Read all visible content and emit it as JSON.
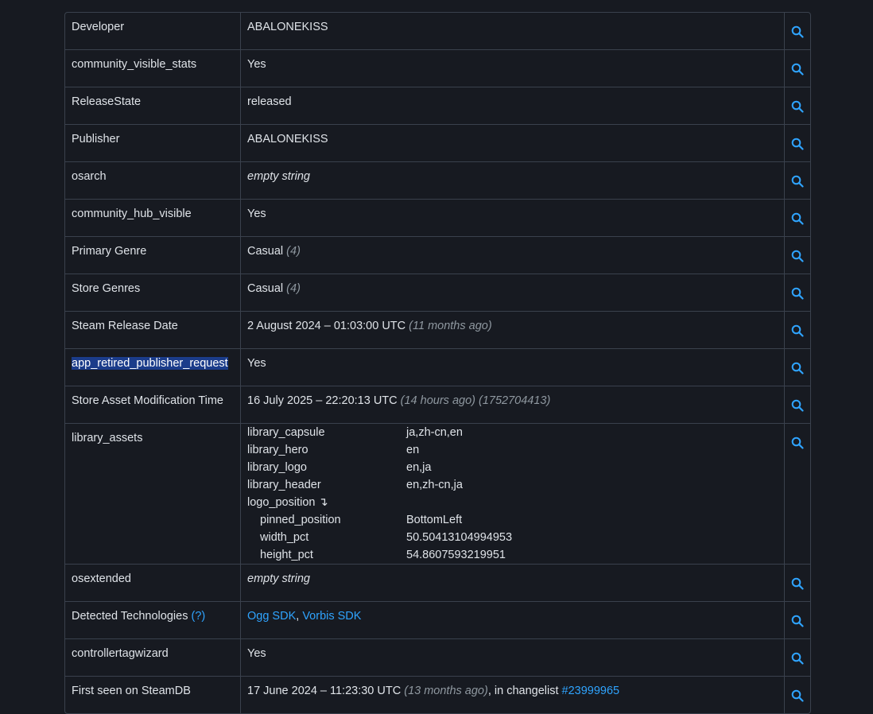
{
  "rows": [
    {
      "key": "Developer",
      "value": "ABALONEKISS"
    },
    {
      "key": "community_visible_stats",
      "value": "Yes"
    },
    {
      "key": "ReleaseState",
      "value": "released"
    },
    {
      "key": "Publisher",
      "value": "ABALONEKISS"
    },
    {
      "key": "osarch",
      "value": "empty string"
    },
    {
      "key": "community_hub_visible",
      "value": "Yes"
    },
    {
      "key": "Primary Genre",
      "value": "Casual",
      "extra": "(4)"
    },
    {
      "key": "Store Genres",
      "value": "Casual",
      "extra": "(4)"
    },
    {
      "key": "Steam Release Date",
      "value": "2 August 2024 – 01:03:00 UTC",
      "extra": "(11 months ago)"
    },
    {
      "key": "app_retired_publisher_request",
      "value": "Yes"
    },
    {
      "key": "Store Asset Modification Time",
      "value": "16 July 2025 – 22:20:13 UTC",
      "extra": "(14 hours ago)",
      "extra2": "(1752704413)"
    },
    {
      "key": "library_assets"
    },
    {
      "key": "osextended",
      "value": "empty string"
    },
    {
      "key": "Detected Technologies",
      "help": "(?)",
      "tech1": "Ogg SDK",
      "sep": ",",
      "tech2": "Vorbis SDK"
    },
    {
      "key": "controllertagwizard",
      "value": "Yes"
    },
    {
      "key": "First seen on SteamDB",
      "value": "17 June 2024 – 11:23:30 UTC",
      "extra": "(13 months ago)",
      "mid": ", in changelist",
      "link": "#23999965"
    }
  ],
  "library_assets": [
    {
      "k": "library_capsule",
      "v": "ja,zh-cn,en"
    },
    {
      "k": "library_hero",
      "v": "en"
    },
    {
      "k": "library_logo",
      "v": "en,ja"
    },
    {
      "k": "library_header",
      "v": "en,zh-cn,ja"
    },
    {
      "k": "logo_position",
      "arrow": "↴"
    },
    {
      "k": "pinned_position",
      "v": "BottomLeft"
    },
    {
      "k": "width_pct",
      "v": "50.50413104994953"
    },
    {
      "k": "height_pct",
      "v": "54.8607593219951"
    }
  ],
  "search_icon": "search-icon",
  "colors": {
    "background": "#171a21",
    "border": "#3a414d",
    "link": "#2fa4ff",
    "highlight": "#1b3c8a",
    "muted": "#8f98a0"
  }
}
